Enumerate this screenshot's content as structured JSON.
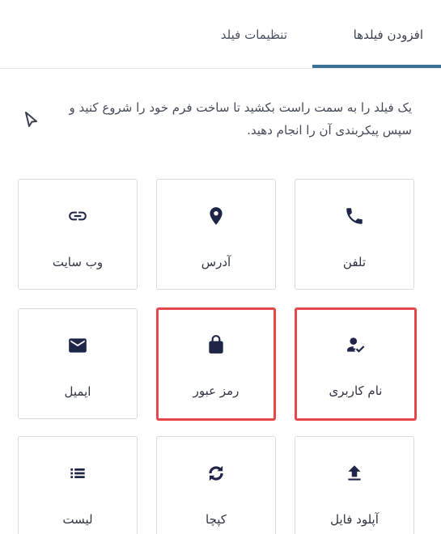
{
  "tabs": {
    "add_fields": "افزودن فیلدها",
    "field_settings": "تنظیمات فیلد"
  },
  "instruction": "یک فیلد را به سمت راست بکشید تا ساخت فرم خود را شروع کنید و سپس پیکربندی آن را انجام دهید.",
  "fields": [
    {
      "label": "تلفن",
      "icon": "phone-icon"
    },
    {
      "label": "آدرس",
      "icon": "location-pin-icon"
    },
    {
      "label": "وب سایت",
      "icon": "link-icon"
    },
    {
      "label": "نام کاربری",
      "icon": "user-check-icon",
      "highlighted": true
    },
    {
      "label": "رمز عبور",
      "icon": "lock-icon",
      "highlighted": true
    },
    {
      "label": "ایمیل",
      "icon": "envelope-icon"
    },
    {
      "label": "آپلود فایل",
      "icon": "upload-icon"
    },
    {
      "label": "کپچا",
      "icon": "captcha-icon"
    },
    {
      "label": "لیست",
      "icon": "list-icon"
    }
  ],
  "colors": {
    "accent": "#3b6f93",
    "icon": "#1f2547",
    "highlight": "#e5474d"
  }
}
